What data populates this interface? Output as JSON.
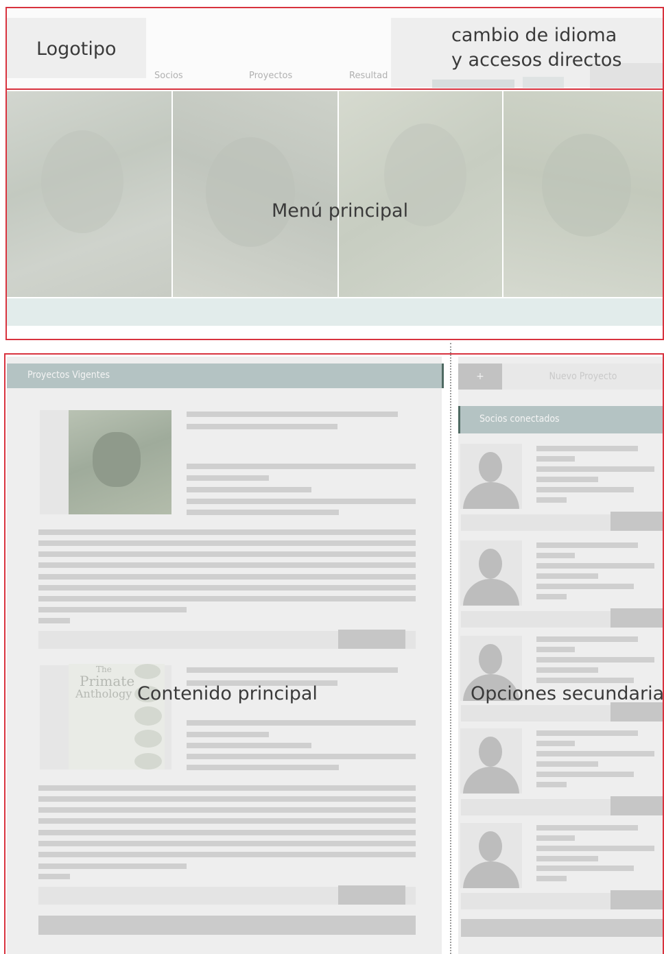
{
  "labels": {
    "logo": "Logotipo",
    "lang_line1": "cambio de idioma",
    "lang_line2": "y accesos directos",
    "main_menu": "Menú principal",
    "main_content": "Contenido principal",
    "secondary": "Opciones secundarias"
  },
  "nav": [
    "Socios",
    "Proyectos",
    "Resultad"
  ],
  "panels": {
    "projects_title": "Proyectos Vigentes",
    "new_project": "Nuevo Proyecto",
    "new_project_icon": "+",
    "partners_title": "Socios conectados"
  },
  "book": {
    "line1": "The",
    "line2": "Primate",
    "line3": "Anthology"
  },
  "colors": {
    "outline": "#d8323e",
    "panel_header": "#b4c3c3",
    "placeholder": "#cfcfcf"
  }
}
